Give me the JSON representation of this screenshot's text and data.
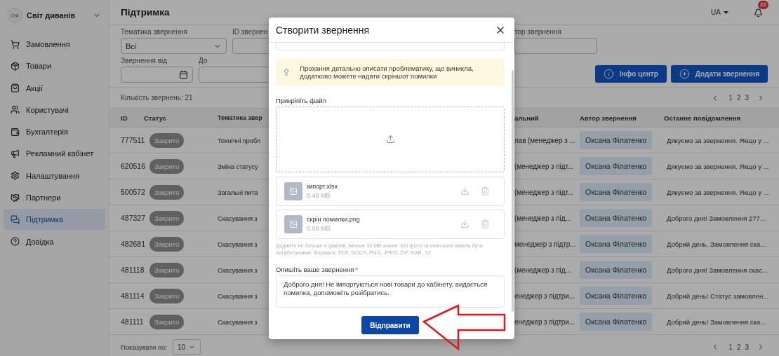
{
  "sidebar": {
    "avatar": "ОФ",
    "shop": "Світ диванів",
    "items": [
      {
        "label": "Замовлення",
        "kind": "cart",
        "selected": false
      },
      {
        "label": "Товари",
        "kind": "box",
        "selected": false
      },
      {
        "label": "Акції",
        "kind": "bag",
        "selected": false
      },
      {
        "label": "Користувачі",
        "kind": "users",
        "selected": false
      },
      {
        "label": "Бухгалтерія",
        "kind": "wallet",
        "selected": false
      },
      {
        "label": "Рекламний кабінет",
        "kind": "megaphone",
        "selected": false
      },
      {
        "label": "Налаштування",
        "kind": "settings",
        "selected": false
      },
      {
        "label": "Партнери",
        "kind": "handshake",
        "selected": false
      },
      {
        "label": "Підтримка",
        "kind": "chat",
        "selected": true
      },
      {
        "label": "Довідка",
        "kind": "help",
        "selected": false
      }
    ]
  },
  "header": {
    "title": "Підтримка",
    "language": "UA",
    "notifications": "22"
  },
  "filters": {
    "topic": {
      "label": "Тематика звернення",
      "value": "Всі"
    },
    "id": {
      "label": "ID звернен"
    },
    "author": {
      "label": "тор звернення"
    },
    "date_from": {
      "label": "Звернення від"
    },
    "date_to": {
      "label": "До"
    }
  },
  "actions": [
    {
      "label": "Інфо центр",
      "kind": "info"
    },
    {
      "label": "Додати звернення",
      "kind": "add"
    }
  ],
  "count": "Кількість звернень: 21",
  "pagination_top": [
    {
      "label": "1",
      "selected": true
    },
    {
      "label": "2",
      "selected": false
    },
    {
      "label": "3",
      "selected": false
    }
  ],
  "table": {
    "columns": [
      "ID",
      "Статус",
      "Тематика звер",
      "альний",
      "Автор звернення",
      "Останнє повідомлення"
    ],
    "rows": [
      {
        "id": "777511",
        "status": "Закрито",
        "topic": "Технічні пробл",
        "assignee": "лав (менеджер з ...",
        "author": "Оксана Філатенко",
        "last_message": "Дякуємо за звернення. Якщо у ..."
      },
      {
        "id": "620516",
        "status": "Закрито",
        "topic": "Зміна статусу",
        "assignee": "(менеджер з підт...",
        "author": "Оксана Філатенко",
        "last_message": "Дякуємо за звернення. Якщо у ..."
      },
      {
        "id": "500572",
        "status": "Закрито",
        "topic": "Загальні пита",
        "assignee": "(менеджер з підт...",
        "author": "Оксана Філатенко",
        "last_message": "Дякуємо за звернення. Якщо у ..."
      },
      {
        "id": "487327",
        "status": "Закрито",
        "topic": "Скасування з",
        "assignee": "(менеджер з під...",
        "author": "Оксана Філатенко",
        "last_message": "Доброго дня! Замовлення 277..."
      },
      {
        "id": "482681",
        "status": "Закрито",
        "topic": "Скасування з",
        "assignee": "менеджер з підтр...",
        "author": "Оксана Філатенко",
        "last_message": "Добрий день. Замовлення ска..."
      },
      {
        "id": "481118",
        "status": "Закрито",
        "topic": "Скасування з",
        "assignee": "(менеджер з під...",
        "author": "Оксана Філатенко",
        "last_message": "Доброго дня! Замовлення скас..."
      },
      {
        "id": "481114",
        "status": "Закрито",
        "topic": "Скасування з",
        "assignee": "енеджер з підтри...",
        "author": "Оксана Філатенко",
        "last_message": "Добрий день! Статус замовлен..."
      },
      {
        "id": "481111",
        "status": "Закрито",
        "topic": "Скасування з",
        "assignee": "енеджер з підтри...",
        "author": "Оксана Філатенко",
        "last_message": "Добрий день! Замовлення ска..."
      }
    ]
  },
  "footer": {
    "label": "Показувати по:",
    "page_size": "10"
  },
  "pagination_bottom": [
    {
      "label": "1",
      "selected": true
    },
    {
      "label": "2",
      "selected": false
    },
    {
      "label": "3",
      "selected": false
    }
  ],
  "modal": {
    "title": "Створити звернення",
    "tip": "Прохання детально описати проблематику, що виникла, додатково можете надати скріншот помилки",
    "attach_label": "Прикріпіть файл",
    "files": [
      {
        "name": "імпорт.xlsx",
        "size": "0.46 MB"
      },
      {
        "name": "скрін помилки.png",
        "size": "0.08 MB"
      }
    ],
    "hint": "Додайте не більше 4 файлів, менше 10 MB кожен. Всі фото та скан-копії мають бути читабельними. Формати: PDF, DOCX, PNG, JPEG, ZIP, RAR, 7Z",
    "description_label": "Опишіть ваше звернення",
    "required_mark": "*",
    "description": "Доброго дня! Не імпортуються нові товари до кабінету, видається помилка, допоможіть розібратись.",
    "submit": "Відправити"
  }
}
